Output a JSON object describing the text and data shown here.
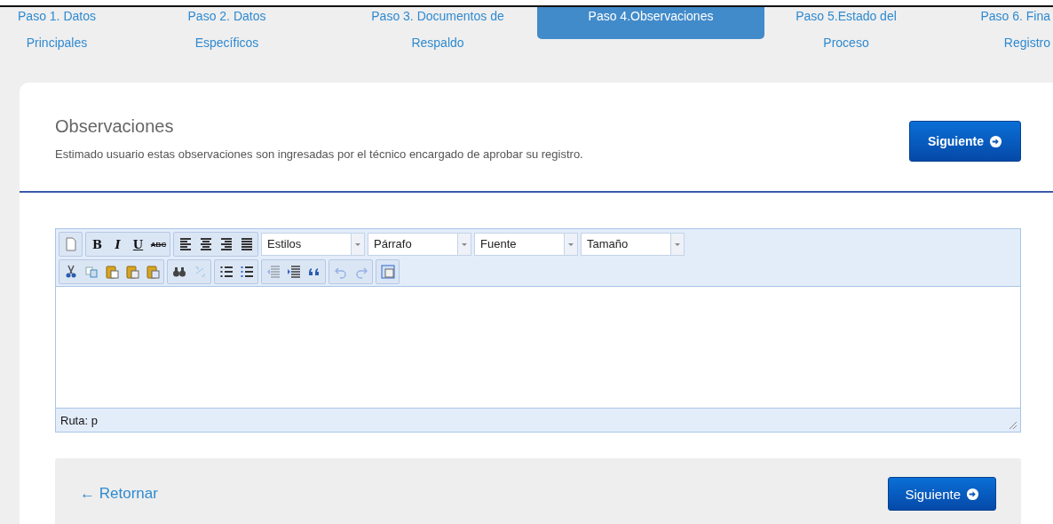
{
  "tabs": [
    {
      "lines": [
        "Paso 1. Datos",
        "Principales"
      ],
      "selected": false
    },
    {
      "lines": [
        "Paso 2. Datos",
        "Específicos"
      ],
      "selected": false
    },
    {
      "lines": [
        "Paso 3. Documentos de",
        "Respaldo"
      ],
      "selected": false
    },
    {
      "lines": [
        "Paso 4.Observaciones"
      ],
      "selected": true
    },
    {
      "lines": [
        "Paso 5.Estado del",
        "Proceso"
      ],
      "selected": false
    },
    {
      "lines": [
        "Paso 6. Fina",
        "Registro"
      ],
      "selected": false
    }
  ],
  "section": {
    "title": "Observaciones",
    "description": "Estimado usuario estas observaciones son ingresadas por el técnico encargado de aprobar su registro.",
    "next_button": "Siguiente"
  },
  "editor": {
    "toolbar_rows": [
      [
        [
          {
            "kind": "icon",
            "disabled": false
          }
        ],
        [
          {
            "kind": "text",
            "label": "B",
            "disabled": false
          },
          {
            "kind": "text",
            "label": "I",
            "disabled": false
          },
          {
            "kind": "text",
            "label": "U",
            "disabled": false
          },
          {
            "kind": "text",
            "label": "ABC",
            "disabled": false
          }
        ],
        [
          {
            "kind": "icon",
            "disabled": false
          },
          {
            "kind": "icon",
            "disabled": false
          },
          {
            "kind": "icon",
            "disabled": false
          },
          {
            "kind": "icon",
            "disabled": false
          }
        ]
      ],
      [
        [
          {
            "kind": "icon",
            "disabled": false
          },
          {
            "kind": "icon",
            "disabled": false
          },
          {
            "kind": "icon",
            "disabled": false
          },
          {
            "kind": "icon",
            "disabled": false
          },
          {
            "kind": "icon",
            "disabled": false
          }
        ],
        [
          {
            "kind": "icon",
            "disabled": false
          },
          {
            "kind": "icon",
            "disabled": true
          }
        ],
        [
          {
            "kind": "icon",
            "disabled": false
          },
          {
            "kind": "icon",
            "disabled": false
          }
        ],
        [
          {
            "kind": "icon",
            "disabled": true
          },
          {
            "kind": "icon",
            "disabled": false
          },
          {
            "kind": "icon",
            "disabled": false
          }
        ],
        [
          {
            "kind": "icon",
            "disabled": true
          },
          {
            "kind": "icon",
            "disabled": true
          }
        ],
        [
          {
            "kind": "icon",
            "disabled": false
          }
        ]
      ]
    ],
    "dropdowns": [
      "Estilos",
      "Párrafo",
      "Fuente",
      "Tamaño"
    ],
    "path": "Ruta: p"
  },
  "footer": {
    "back_link": "← Retornar",
    "next_button": "Siguiente"
  }
}
